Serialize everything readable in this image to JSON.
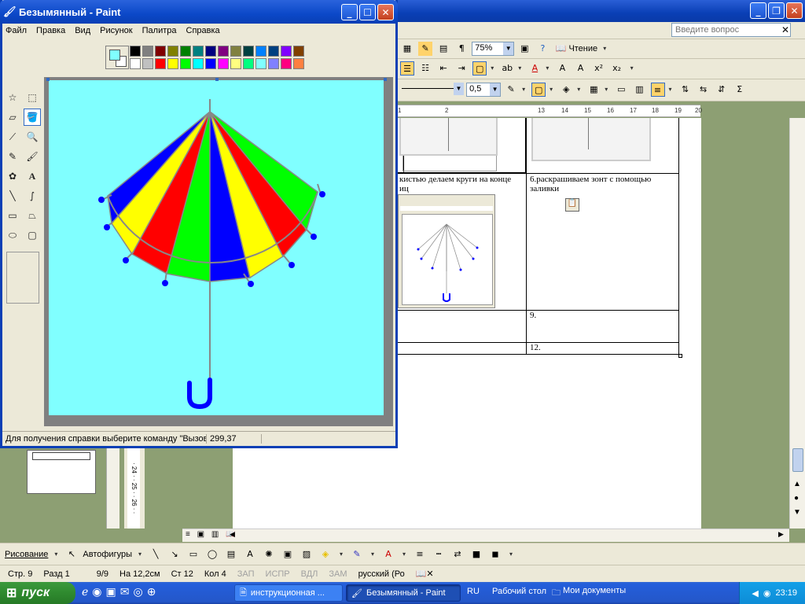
{
  "word": {
    "help_placeholder": "Введите вопрос",
    "zoom": "75%",
    "read_label": "Чтение",
    "line_width": "0,5",
    "ruler_marks": [
      "1",
      "2",
      "13",
      "14",
      "15",
      "16",
      "17",
      "18",
      "19",
      "20"
    ],
    "cell_text_left": "кистью делаем круги на конце\nиц",
    "cell_text_right": "6.раскрашиваем зонт с помощью заливки",
    "cell_9": "9.",
    "cell_12": "12.",
    "drawbar": {
      "draw_label": "Рисование",
      "autoshapes_label": "Автофигуры"
    },
    "status": {
      "page": "Стр. 9",
      "section": "Разд 1",
      "pages": "9/9",
      "at": "На 12,2см",
      "line": "Ст 12",
      "col": "Кол 4",
      "rec": "ЗАП",
      "trk": "ИСПР",
      "ext": "ВДЛ",
      "ovr": "ЗАМ",
      "lang": "русский (Ро"
    }
  },
  "paint": {
    "title": "Безымянный - Paint",
    "menu": [
      "Файл",
      "Правка",
      "Вид",
      "Рисунок",
      "Палитра",
      "Справка"
    ],
    "palette_top": [
      "#000000",
      "#808080",
      "#800000",
      "#808000",
      "#008000",
      "#008080",
      "#000080",
      "#800080",
      "#808040",
      "#004040",
      "#0080ff",
      "#004080",
      "#8000ff",
      "#804000"
    ],
    "palette_bottom": [
      "#ffffff",
      "#c0c0c0",
      "#ff0000",
      "#ffff00",
      "#00ff00",
      "#00ffff",
      "#0000ff",
      "#ff00ff",
      "#ffff80",
      "#00ff80",
      "#80ffff",
      "#8080ff",
      "#ff0080",
      "#ff8040"
    ],
    "fg_color": "#80ffff",
    "bg_color": "#ffffff",
    "canvas_bg": "#80ffff",
    "status_help": "Для получения справки выберите команду \"Вызов",
    "coords": "299,37",
    "umbrella_colors": [
      "#0000ff",
      "#ffff00",
      "#ff0000",
      "#00ff00",
      "#0000ff",
      "#ffff00",
      "#ff0000",
      "#00ff00"
    ]
  },
  "taskbar": {
    "start_label": "пуск",
    "tasks": [
      "инструкционная ...",
      "Безымянный - Paint"
    ],
    "lang": "RU",
    "desktop_label": "Рабочий стол",
    "mydocs_label": "Мои документы",
    "time": "23:19"
  }
}
